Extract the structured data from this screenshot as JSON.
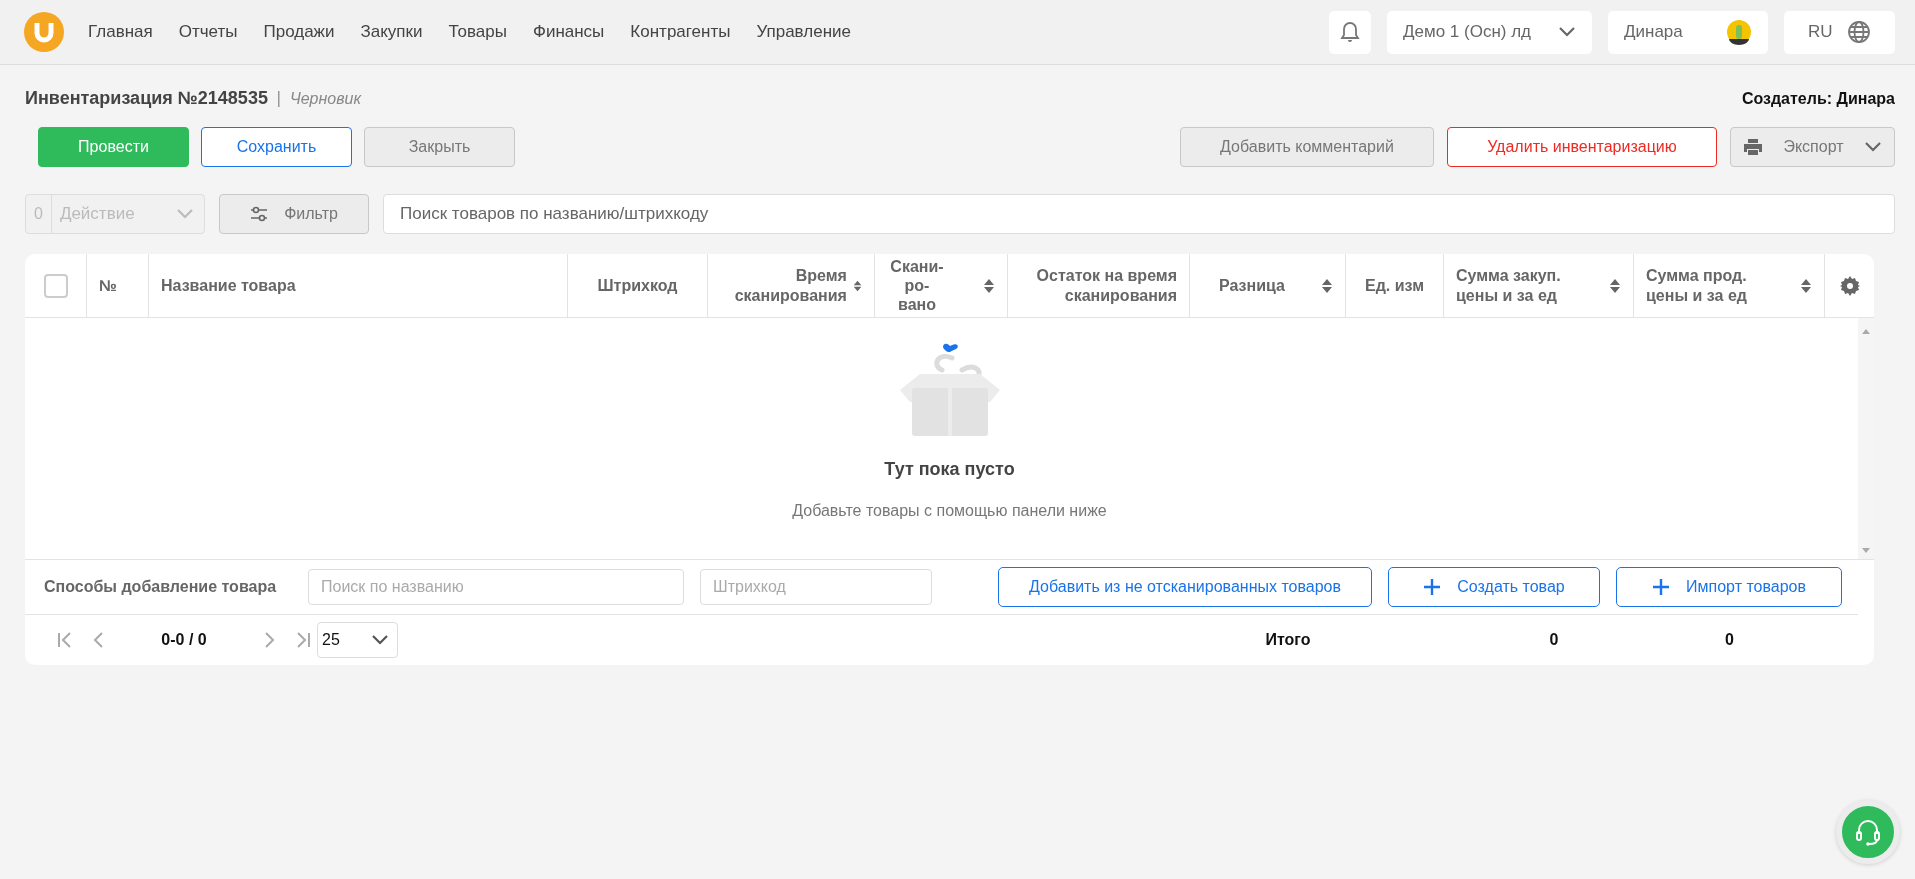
{
  "nav": {
    "items": [
      "Главная",
      "Отчеты",
      "Продажи",
      "Закупки",
      "Товары",
      "Финансы",
      "Контрагенты",
      "Управление"
    ],
    "company": "Демо 1 (Осн) лд",
    "user": "Динара",
    "language": "RU"
  },
  "document": {
    "title": "Инвентаризация №2148535",
    "status": "Черновик",
    "creator": "Создатель: Динара"
  },
  "actions": {
    "left": [
      {
        "label": "Провести",
        "kind": "success"
      },
      {
        "label": "Сохранить",
        "kind": "primary"
      },
      {
        "label": "Закрыть",
        "kind": "secondary"
      }
    ],
    "right": [
      {
        "label": "Добавить комментарий",
        "kind": "secondary"
      },
      {
        "label": "Удалить инвентаризацию",
        "kind": "danger"
      },
      {
        "label": "Экспорт",
        "kind": "export"
      }
    ]
  },
  "toolbar": {
    "selected_count": "0",
    "action": {
      "label": "Действие",
      "disabled": true
    },
    "filter": "Фильтр",
    "search": {
      "placeholder": "Поиск товаров по названию/штрихкоду"
    }
  },
  "table": {
    "select_all": {
      "checked": false
    },
    "columns": [
      {
        "label": "№",
        "sortable": false
      },
      {
        "label": "Название товара",
        "sortable": false
      },
      {
        "label": "Штрихкод",
        "sortable": false
      },
      {
        "label": "Время сканирования",
        "sortable": true
      },
      {
        "label": "Скани-ро-вано",
        "sortable": true
      },
      {
        "label": "Остаток на время сканирования",
        "sortable": false
      },
      {
        "label": "Разница",
        "sortable": true
      },
      {
        "label": "Ед. изм",
        "sortable": false
      },
      {
        "label": "Сумма закуп. цены и за ед",
        "sortable": true
      },
      {
        "label": "Сумма прод. цены и за ед",
        "sortable": true
      }
    ],
    "empty": {
      "title": "Тут пока пусто",
      "hint": "Добавьте товары с помощью панели ниже"
    },
    "add_panel": {
      "label": "Способы добавление товара",
      "name_field": {
        "placeholder": "Поиск по названию"
      },
      "barcode_field": {
        "placeholder": "Штрихкод"
      },
      "buttons": [
        {
          "label": "Добавить из не отсканированных товаров",
          "kind": "plain"
        },
        {
          "label": "Создать товар",
          "kind": "plus"
        },
        {
          "label": "Импорт товаров",
          "kind": "plus"
        }
      ]
    },
    "pagination": {
      "range": "0-0 / 0",
      "page_size": "25"
    },
    "totals": {
      "label": "Итого",
      "purchase_sum": "0",
      "sale_sum": "0"
    }
  }
}
